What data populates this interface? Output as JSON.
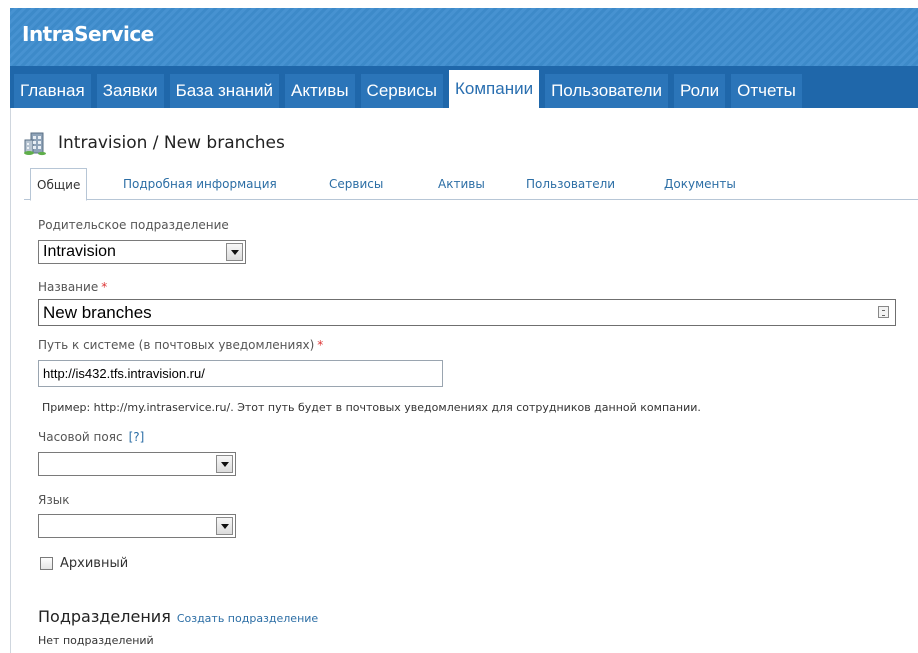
{
  "app": {
    "title": "IntraService"
  },
  "nav": {
    "tabs": [
      {
        "label": "Главная"
      },
      {
        "label": "Заявки"
      },
      {
        "label": "База знаний"
      },
      {
        "label": "Активы"
      },
      {
        "label": "Сервисы"
      },
      {
        "label": "Компании",
        "active": true
      },
      {
        "label": "Пользователи"
      },
      {
        "label": "Роли"
      },
      {
        "label": "Отчеты"
      }
    ]
  },
  "page": {
    "title": "Intravision / New branches",
    "icon": "building-icon"
  },
  "subtabs": [
    {
      "label": "Общие",
      "active": true
    },
    {
      "label": "Подробная информация"
    },
    {
      "label": "Сервисы"
    },
    {
      "label": "Активы"
    },
    {
      "label": "Пользователи"
    },
    {
      "label": "Документы"
    }
  ],
  "form": {
    "parent": {
      "label": "Родительское подразделение",
      "value": "Intravision"
    },
    "name": {
      "label": "Название",
      "required_mark": "*",
      "value": "New branches"
    },
    "path": {
      "label": "Путь к системе (в почтовых уведомлениях)",
      "required_mark": "*",
      "value": "http://is432.tfs.intravision.ru/",
      "hint": "Пример: http://my.intraservice.ru/. Этот путь будет в почтовых уведомлениях для сотрудников данной компании."
    },
    "timezone": {
      "label": "Часовой пояс",
      "help": "[?]",
      "value": ""
    },
    "language": {
      "label": "Язык",
      "value": ""
    },
    "archived": {
      "label": "Архивный",
      "checked": false
    }
  },
  "subdivisions": {
    "heading": "Подразделения",
    "create_link": "Создать подразделение",
    "empty_text": "Нет подразделений"
  },
  "colors": {
    "header_blue": "#3d8ac9",
    "nav_blue": "#1f67aa",
    "link_blue": "#2c6ea5",
    "required_red": "#d33333"
  }
}
